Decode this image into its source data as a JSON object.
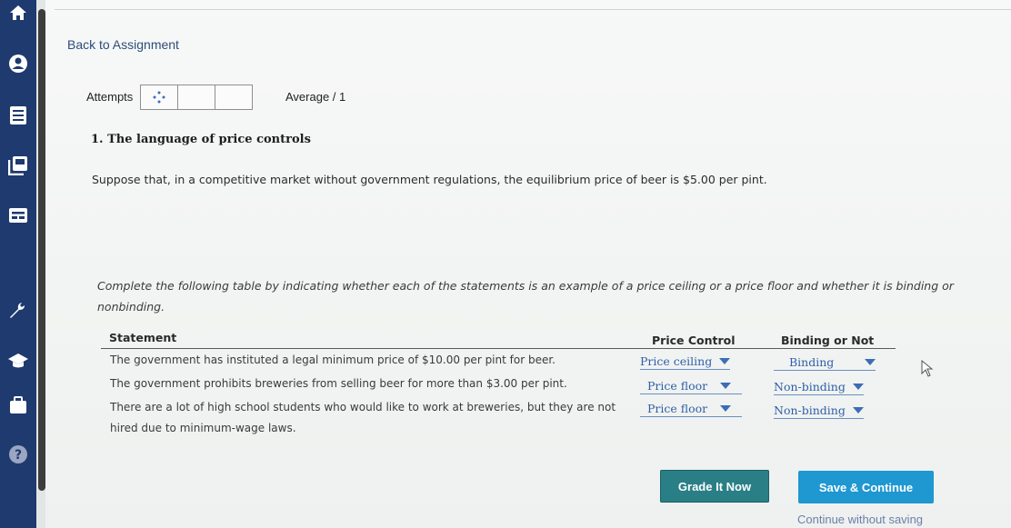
{
  "nav": {
    "back_link": "Back to Assignment",
    "icons": [
      "home-icon",
      "account-icon",
      "assignments-icon",
      "books-icon",
      "gradebook-icon",
      "tools-icon",
      "courses-icon",
      "briefcase-icon",
      "help-icon"
    ],
    "help_glyph": "?"
  },
  "header": {
    "attempts_label": "Attempts",
    "average_label": "Average / 1"
  },
  "question": {
    "title": "1. The language of price controls",
    "scenario": "Suppose that, in a competitive market without government regulations, the equilibrium price of beer is $5.00 per pint.",
    "instructions": "Complete the following table by indicating whether each of the statements is an example of a price ceiling or a price floor and whether it is binding or nonbinding."
  },
  "table": {
    "headers": {
      "statement": "Statement",
      "price_control": "Price Control",
      "binding": "Binding or Not"
    },
    "rows": [
      {
        "statement": "The government has instituted a legal minimum price of $10.00 per pint for beer.",
        "price_control": "Price ceiling",
        "binding": "Binding"
      },
      {
        "statement": "The government prohibits breweries from selling beer for more than $3.00 per pint.",
        "price_control": "Price floor",
        "binding": "Non-binding"
      },
      {
        "statement": "There are a lot of high school students who would like to work at breweries, but they are not hired due to minimum-wage laws.",
        "price_control": "Price floor",
        "binding": "Non-binding"
      }
    ]
  },
  "actions": {
    "grade_label": "Grade It Now",
    "save_label": "Save & Continue",
    "continue_label": "Continue without saving"
  },
  "colors": {
    "sidebar": "#1f3a6e",
    "grade_button": "#2a7f86",
    "save_button": "#1f97d1",
    "dropdown_text": "#2f5fa8"
  }
}
